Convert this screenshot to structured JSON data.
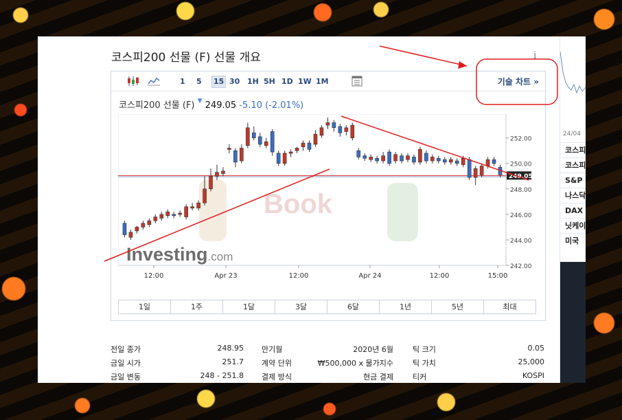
{
  "header": {
    "title": "코스피200 선물 (F) 선물 개요",
    "info_icon": "i"
  },
  "toolbar": {
    "intervals": [
      "1",
      "5",
      "15",
      "30",
      "1H",
      "5H",
      "1D",
      "1W",
      "1M"
    ],
    "selected": "15",
    "technical_link": "기술 차트 »"
  },
  "quote": {
    "name": "코스피200 선물 (F)",
    "price": "249.05",
    "change": "-5.10",
    "change_pct": "(-2.01%)"
  },
  "watermarks": {
    "investing_brand": "Investing",
    "investing_suffix": ".com",
    "book": "Book"
  },
  "chart_data": {
    "type": "candlestick",
    "x_ticks": [
      "12:00",
      "Apr 23",
      "12:00",
      "Apr 24",
      "12:00",
      "15:00"
    ],
    "y_ticks": [
      "252.00",
      "250.00",
      "248.00",
      "246.00",
      "244.00",
      "242.00"
    ],
    "ylim": [
      242,
      253.6
    ],
    "current_price_label": "249.05",
    "current_price": 249.05,
    "reference_level": 248.95,
    "candles": [
      [
        244.4,
        245.3,
        244.2,
        245.5,
        "bear"
      ],
      [
        244.6,
        244.2,
        244.0,
        244.8,
        "bull"
      ],
      [
        244.7,
        245.0,
        244.5,
        245.1,
        "bull"
      ],
      [
        245.0,
        245.3,
        244.8,
        245.5,
        "bull"
      ],
      [
        245.2,
        245.5,
        245.0,
        245.7,
        "bull"
      ],
      [
        245.5,
        245.8,
        245.3,
        246.0,
        "bull"
      ],
      [
        245.7,
        246.0,
        245.5,
        246.2,
        "bull"
      ],
      [
        245.9,
        246.2,
        245.7,
        246.4,
        "bull"
      ],
      [
        246.0,
        245.9,
        245.7,
        246.2,
        "bear"
      ],
      [
        246.0,
        246.1,
        245.8,
        246.3,
        "bull"
      ],
      [
        245.8,
        246.6,
        245.6,
        246.8,
        "bull"
      ],
      [
        246.5,
        246.6,
        246.3,
        246.9,
        "bull"
      ],
      [
        246.5,
        246.9,
        246.3,
        247.1,
        "bull"
      ],
      [
        246.9,
        248.0,
        246.7,
        249.0,
        "bull"
      ],
      [
        248.0,
        249.0,
        247.8,
        249.6,
        "bull"
      ],
      [
        249.0,
        249.3,
        248.7,
        249.9,
        "bull"
      ],
      [
        249.2,
        249.4,
        249.0,
        249.7,
        "bull"
      ],
      [
        251.1,
        251.2,
        250.8,
        251.5,
        "bull"
      ],
      [
        251.0,
        250.1,
        249.7,
        251.2,
        "bear"
      ],
      [
        250.2,
        251.2,
        250.0,
        251.5,
        "bull"
      ],
      [
        251.4,
        252.8,
        251.2,
        253.2,
        "bull"
      ],
      [
        252.4,
        252.0,
        251.8,
        252.9,
        "bear"
      ],
      [
        252.1,
        251.5,
        251.3,
        252.4,
        "bear"
      ],
      [
        251.4,
        251.7,
        251.2,
        252.0,
        "bull"
      ],
      [
        252.5,
        250.9,
        250.6,
        252.7,
        "bear"
      ],
      [
        250.8,
        250.0,
        249.8,
        251.0,
        "bear"
      ],
      [
        250.0,
        250.8,
        249.8,
        251.0,
        "bull"
      ],
      [
        250.8,
        250.9,
        250.5,
        251.1,
        "bull"
      ],
      [
        251.0,
        251.2,
        250.8,
        251.3,
        "bull"
      ],
      [
        251.3,
        251.6,
        251.0,
        251.8,
        "bull"
      ],
      [
        251.6,
        251.1,
        250.9,
        251.8,
        "bear"
      ],
      [
        251.5,
        252.3,
        251.3,
        252.6,
        "bull"
      ],
      [
        252.2,
        252.8,
        252.0,
        253.0,
        "bull"
      ],
      [
        253.0,
        253.2,
        252.7,
        253.6,
        "bull"
      ],
      [
        253.2,
        252.8,
        252.5,
        253.4,
        "bear"
      ],
      [
        252.9,
        252.4,
        252.1,
        253.1,
        "bear"
      ],
      [
        252.5,
        252.8,
        252.2,
        253.0,
        "bull"
      ],
      [
        253.0,
        252.0,
        251.8,
        253.2,
        "bull"
      ],
      [
        251.0,
        250.5,
        250.3,
        251.2,
        "bear"
      ],
      [
        250.6,
        250.4,
        250.2,
        250.8,
        "bear"
      ],
      [
        250.3,
        250.5,
        250.1,
        250.7,
        "bull"
      ],
      [
        250.4,
        250.2,
        250.0,
        250.6,
        "bear"
      ],
      [
        250.2,
        250.6,
        250.0,
        250.9,
        "bull"
      ],
      [
        250.9,
        250.0,
        249.8,
        251.1,
        "bear"
      ],
      [
        250.2,
        250.7,
        250.0,
        250.9,
        "bull"
      ],
      [
        250.6,
        250.2,
        250.0,
        250.8,
        "bear"
      ],
      [
        250.3,
        250.6,
        250.1,
        250.8,
        "bull"
      ],
      [
        250.5,
        250.1,
        249.9,
        250.7,
        "bear"
      ],
      [
        250.1,
        251.1,
        249.9,
        251.3,
        "bull"
      ],
      [
        250.8,
        250.2,
        250.0,
        251.0,
        "bear"
      ],
      [
        250.2,
        250.5,
        250.0,
        250.7,
        "bull"
      ],
      [
        250.4,
        250.2,
        250.0,
        250.6,
        "bear"
      ],
      [
        250.3,
        250.1,
        249.9,
        250.5,
        "bear"
      ],
      [
        250.1,
        250.3,
        249.9,
        250.5,
        "bull"
      ],
      [
        250.2,
        250.0,
        249.8,
        250.4,
        "bear"
      ],
      [
        249.9,
        250.4,
        249.7,
        250.6,
        "bull"
      ],
      [
        250.3,
        248.9,
        248.7,
        250.5,
        "bear"
      ],
      [
        248.9,
        249.6,
        248.3,
        249.8,
        "bull"
      ],
      [
        249.1,
        249.8,
        248.9,
        250.0,
        "bull"
      ],
      [
        249.8,
        250.3,
        249.6,
        250.5,
        "bull"
      ],
      [
        250.3,
        250.0,
        249.8,
        250.5,
        "bear"
      ],
      [
        249.7,
        249.1,
        248.9,
        249.9,
        "bear"
      ]
    ]
  },
  "ranges": [
    "1일",
    "1주",
    "1달",
    "3달",
    "6달",
    "1년",
    "5년",
    "최대"
  ],
  "stats": [
    {
      "l1": "전일 종가",
      "v1": "248.95",
      "l2": "만기월",
      "v2": "2020년 6월",
      "l3": "틱 크기",
      "v3": "0.05"
    },
    {
      "l1": "금일 시가",
      "v1": "251.7",
      "l2": "계약 단위",
      "v2": "₩500,000 x 물가지수",
      "l3": "틱 가치",
      "v3": "25,000"
    },
    {
      "l1": "금일 변동",
      "v1": "248 - 251.8",
      "l2": "결제 방식",
      "v2": "현금 결제",
      "l3": "티커",
      "v3": "KOSPI"
    }
  ],
  "sidebar": {
    "date": "24/04",
    "items": [
      "코스피",
      "코스피",
      "S&P",
      "나스닥",
      "DAX",
      "닛케이",
      "미국"
    ]
  },
  "colors": {
    "bull": "#c0392b",
    "bear": "#3a6ec4",
    "annotation": "#e01b1b",
    "link": "#2a4a7c"
  }
}
